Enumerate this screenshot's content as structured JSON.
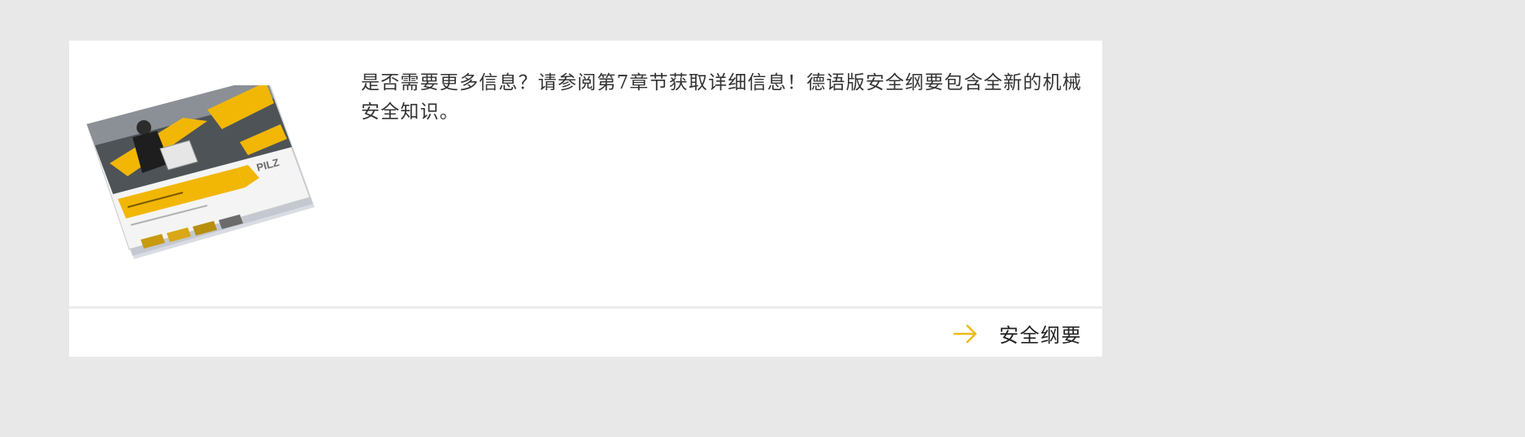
{
  "card": {
    "image_alt_brand": "PILZ",
    "description": "是否需要更多信息？请参阅第7章节获取详细信息！德语版安全纲要包含全新的机械安全知识。",
    "link_label": "安全纲要",
    "accent_color": "#f0b81a"
  }
}
